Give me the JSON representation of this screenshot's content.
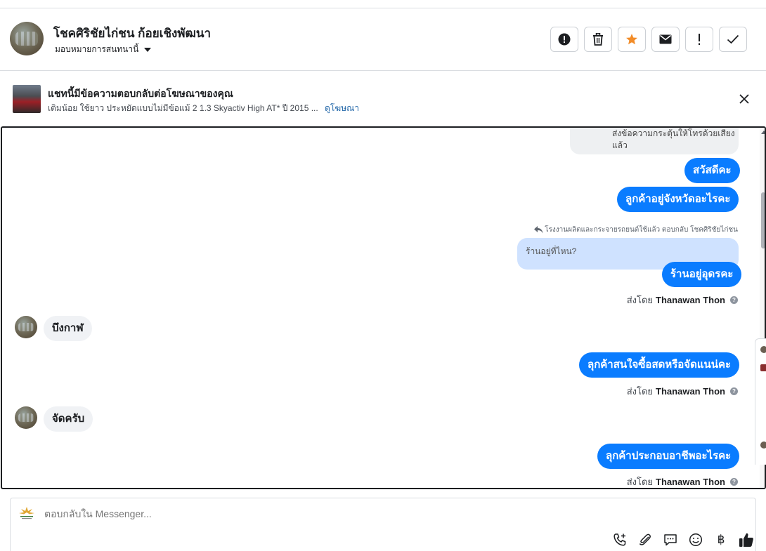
{
  "header": {
    "name": "โชคศิริชัยไก่ชน ก้อยเชิงพัฒนา",
    "assign_label": "มอบหมายการสนทนานี้",
    "action_icons": [
      "alert-circle-icon",
      "trash-icon",
      "star-icon",
      "envelope-icon",
      "exclamation-icon",
      "check-icon"
    ],
    "star_color": "#f28c28"
  },
  "ad_banner": {
    "title": "แชทนี้มีข้อความตอบกลับต่อโฆษณาของคุณ",
    "subtitle": "เติมน้อย ใช้ยาว ประหยัดแบบไม่มีข้อแม้ 2 1.3 Skyactiv High AT* ปี 2015 ...",
    "link": "ดูโฆษณา"
  },
  "chat": {
    "top_partial_text": "ส่งข้อความกระตุ้นให้โทรด้วยเสียงแล้ว",
    "messages": [
      {
        "side": "out",
        "text": "สวัสดีคะ"
      },
      {
        "side": "out",
        "text": "ลูกค้าอยู่จังหวัดอะไรคะ"
      },
      {
        "side": "out",
        "text": "ร้านอยู่อุดรคะ"
      },
      {
        "side": "in",
        "text": "บึงกาฬ"
      },
      {
        "side": "out",
        "text": "ลุกค้าสนใจซื้อสดหรือจัดแนน่คะ"
      },
      {
        "side": "in",
        "text": "จัดครับ"
      },
      {
        "side": "out",
        "text": "ลุกค้าประกอบอาชีพอะไรคะ"
      }
    ],
    "reply_note": "โรงงานผลิตและกระจายรถยนต์ใช้แล้ว ตอบกลับ โชคศิริชัยไก่ชน",
    "quoted_text": "ร้านอยู่ที่ไหน?",
    "sent_by_prefix": "ส่งโดย",
    "sent_by_name": "Thanawan Thon",
    "accent": "#0a7cff"
  },
  "composer": {
    "placeholder": "ตอบกลับใน Messenger...",
    "tools": [
      "phone-plus-icon",
      "paperclip-icon",
      "chat-bubble-icon",
      "smiley-icon",
      "baht-icon",
      "thumbs-up-icon"
    ],
    "baht_symbol": "฿"
  }
}
